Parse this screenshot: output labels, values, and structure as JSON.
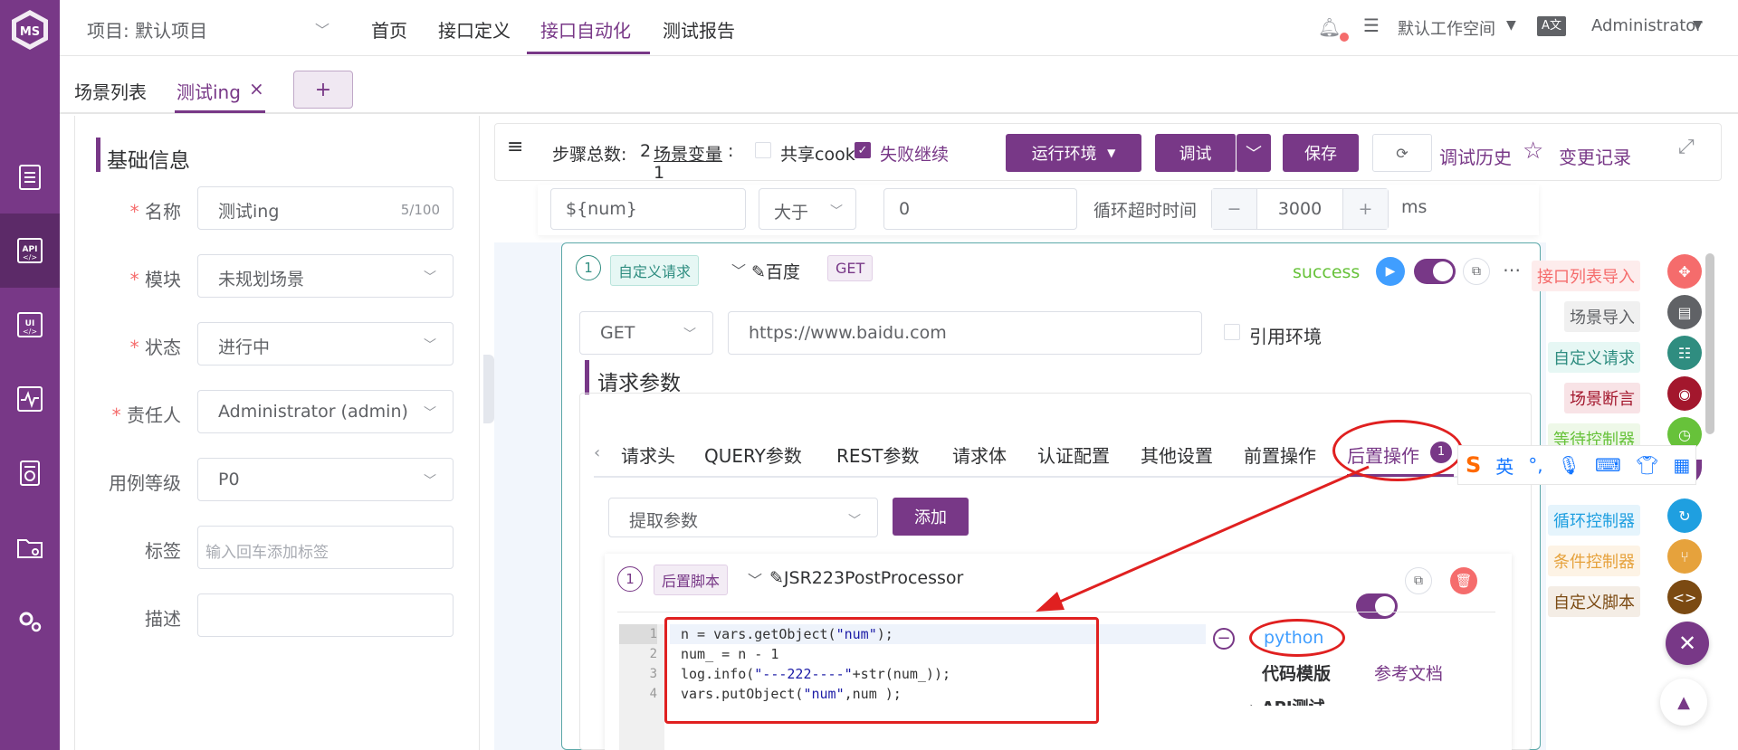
{
  "topbar": {
    "project": "项目: 默认项目",
    "nav": [
      "首页",
      "接口定义",
      "接口自动化",
      "测试报告"
    ],
    "workspace": "默认工作空间",
    "user": "Administrator"
  },
  "tabs": {
    "list": "场景列表",
    "current": "测试ing",
    "close": "×",
    "add": "+"
  },
  "basic": {
    "title": "基础信息",
    "fields": [
      {
        "label": "名称",
        "value": "测试ing",
        "count": "5/100"
      },
      {
        "label": "模块",
        "value": "未规划场景"
      },
      {
        "label": "状态",
        "value": "进行中"
      },
      {
        "label": "责任人",
        "value": "Administrator (admin)"
      },
      {
        "label": "用例等级",
        "value": "P0"
      },
      {
        "label": "标签",
        "placeholder": "输入回车添加标签"
      },
      {
        "label": "描述",
        "value": ""
      }
    ]
  },
  "toolbar": {
    "steps": "步骤总数:",
    "steps_count": "2",
    "vars": "场景变量",
    "vars_sep": ":",
    "vars_count": "1",
    "share_cookie": "共享cook",
    "fail_continue": "失败继续",
    "env": "运行环境",
    "debug": "调试",
    "save": "保存",
    "history": "调试历史",
    "changes": "变更记录"
  },
  "loop": {
    "var": "${num}",
    "op": "大于",
    "value": "0",
    "timeout_label": "循环超时时间",
    "timeout": "3000",
    "unit": "ms",
    "minus": "−",
    "plus": "+"
  },
  "step": {
    "num": "1",
    "type": "自定义请求",
    "name": "百度",
    "method_tag": "GET",
    "status": "success",
    "method": "GET",
    "url": "https://www.baidu.com",
    "use_env": "引用环境",
    "params_title": "请求参数",
    "tabs": [
      "请求头",
      "QUERY参数",
      "REST参数",
      "请求体",
      "认证配置",
      "其他设置",
      "前置操作",
      "后置操作"
    ],
    "post_badge": "1",
    "extract": "提取参数",
    "add": "添加"
  },
  "post": {
    "num": "1",
    "type": "后置脚本",
    "name": "JSR223PostProcessor",
    "lang": "python",
    "template": "代码模版",
    "docs": "参考文档",
    "api_test": "API测试",
    "code": [
      {
        "n": "1",
        "pre": "n = vars.getObject(",
        "str": "\"num\"",
        "post": ");"
      },
      {
        "n": "2",
        "pre": "num_ = n - 1",
        "str": "",
        "post": ""
      },
      {
        "n": "3",
        "pre": "log.info(",
        "str": "\"---222----\"",
        "post": "+str(num_));"
      },
      {
        "n": "4",
        "pre": "vars.putObject(",
        "str": "\"num\"",
        "post": ",num );"
      }
    ]
  },
  "rightpanel": [
    {
      "label": "接口列表导入",
      "color": "#f56c6c",
      "bg": "#fdecec"
    },
    {
      "label": "场景导入",
      "color": "#606266",
      "bg": "#f0f0f0"
    },
    {
      "label": "自定义请求",
      "color": "#2f8d80",
      "bg": "#e6f7f4"
    },
    {
      "label": "场景断言",
      "color": "#a3172d",
      "bg": "#f8e3e6"
    },
    {
      "label": "等待控制器",
      "color": "#67c23a",
      "bg": "#eef8e8"
    },
    {
      "label": "循环控制器",
      "color": "#1f9fe0",
      "bg": "#e5f4fc"
    },
    {
      "label": "条件控制器",
      "color": "#e6a23c",
      "bg": "#fdf3e5"
    },
    {
      "label": "自定义脚本",
      "color": "#7b4a12",
      "bg": "#f4ede5"
    }
  ],
  "ime": {
    "label": "英"
  }
}
